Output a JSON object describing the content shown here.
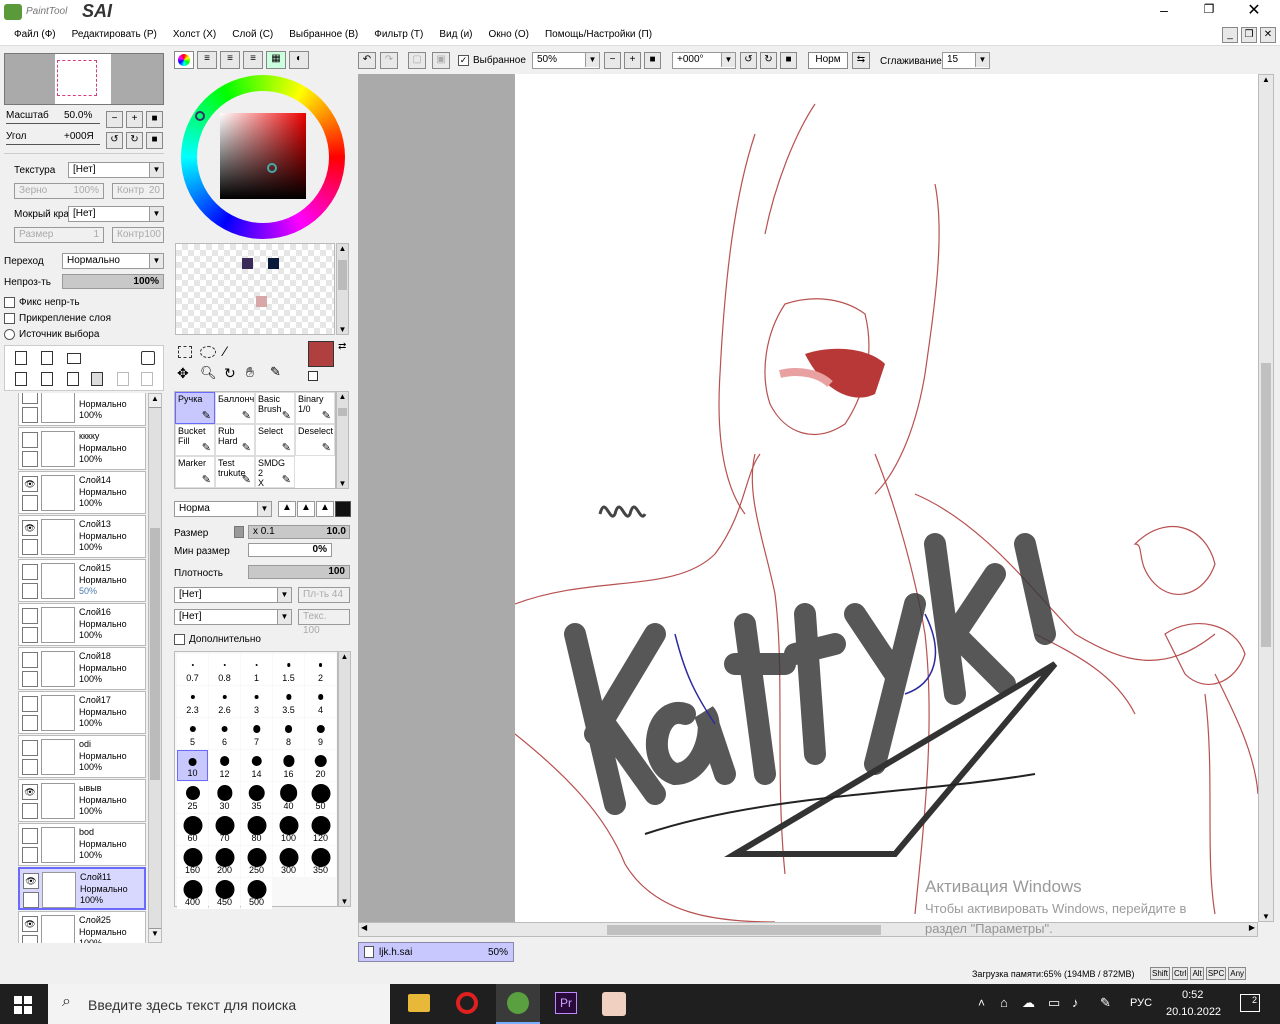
{
  "app": {
    "title_logo": "PaintTool SAI",
    "logo_small": "PaintTool",
    "logo_big": "SAI"
  },
  "menu": [
    "Файл (Ф)",
    "Редактировать (Р)",
    "Холст (Х)",
    "Слой (С)",
    "Выбранное (В)",
    "Фильтр (Т)",
    "Вид (и)",
    "Окно (О)",
    "Помощь/Настройки (П)"
  ],
  "navigator": {
    "zoom_label": "Масштаб",
    "zoom_value": "50.0%",
    "angle_label": "Угол",
    "angle_value": "+000Я"
  },
  "texture": {
    "label": "Текстура",
    "value": "[Нет]",
    "grain_label": "Зерно",
    "grain_value": "100%",
    "contrast_label": "Контр",
    "contrast_value": "20"
  },
  "wet_edge": {
    "label": "Мокрый край",
    "value": "[Нет]",
    "size_label": "Размер",
    "size_value": "1",
    "contrast_label": "Контр",
    "contrast_value": "100"
  },
  "blend": {
    "label": "Переход",
    "value": "Нормально",
    "opacity_label": "Непроз-ть",
    "opacity_value": "100%"
  },
  "options": {
    "fix_opacity": "Фикс непр-ть",
    "clip_layer": "Прикрепление слоя",
    "selection_source": "Источник выбора"
  },
  "layers": [
    {
      "name": "",
      "mode": "Нормально",
      "opacity": "100%",
      "visible": false
    },
    {
      "name": "кккку",
      "mode": "Нормально",
      "opacity": "100%",
      "visible": false
    },
    {
      "name": "Слой14",
      "mode": "Нормально",
      "opacity": "100%",
      "visible": true
    },
    {
      "name": "Слой13",
      "mode": "Нормально",
      "opacity": "100%",
      "visible": true
    },
    {
      "name": "Слой15",
      "mode": "Нормально",
      "opacity": "50%",
      "visible": false
    },
    {
      "name": "Слой16",
      "mode": "Нормально",
      "opacity": "100%",
      "visible": false
    },
    {
      "name": "Слой18",
      "mode": "Нормально",
      "opacity": "100%",
      "visible": false
    },
    {
      "name": "Слой17",
      "mode": "Нормально",
      "opacity": "100%",
      "visible": false
    },
    {
      "name": "odi",
      "mode": "Нормально",
      "opacity": "100%",
      "visible": false
    },
    {
      "name": "ывыв",
      "mode": "Нормально",
      "opacity": "100%",
      "visible": true
    },
    {
      "name": "bod",
      "mode": "Нормально",
      "opacity": "100%",
      "visible": false
    },
    {
      "name": "Слой11",
      "mode": "Нормально",
      "opacity": "100%",
      "visible": true,
      "selected": true
    },
    {
      "name": "Слой25",
      "mode": "Нормально",
      "opacity": "100%",
      "visible": true
    }
  ],
  "colors": {
    "primary": "#b04040",
    "secondary": "#555555",
    "swatch1": "#3a2a5a",
    "swatch2": "#0a1a3a",
    "swatch3": "#d8a8a8"
  },
  "tools": [
    {
      "l1": "Ручка",
      "l2": "",
      "selected": true
    },
    {
      "l1": "Баллонч",
      "l2": ""
    },
    {
      "l1": "Basic",
      "l2": "Brush"
    },
    {
      "l1": "Binary",
      "l2": "1/0"
    },
    {
      "l1": "Bucket",
      "l2": "Fill"
    },
    {
      "l1": "Rub",
      "l2": "Hard"
    },
    {
      "l1": "Select",
      "l2": ""
    },
    {
      "l1": "Deselect",
      "l2": ""
    },
    {
      "l1": "Marker",
      "l2": ""
    },
    {
      "l1": "Test",
      "l2": "trukute"
    },
    {
      "l1": "SMDG 2",
      "l2": "X"
    }
  ],
  "brush": {
    "mode": "Норма",
    "size_label": "Размер",
    "size_mult": "x 0.1",
    "size_value": "10.0",
    "min_size_label": "Мин размер",
    "min_size_value": "0%",
    "density_label": "Плотность",
    "density_value": "100",
    "shape1": "[Нет]",
    "shape1_extra": "Пл-ть 44",
    "shape2": "[Нет]",
    "shape2_extra": "Текс. 100",
    "advanced": "Дополнительно"
  },
  "sizes": [
    "0.7",
    "0.8",
    "1",
    "1.5",
    "2",
    "2.3",
    "2.6",
    "3",
    "3.5",
    "4",
    "5",
    "6",
    "7",
    "8",
    "9",
    "10",
    "12",
    "14",
    "16",
    "20",
    "25",
    "30",
    "35",
    "40",
    "50",
    "60",
    "70",
    "80",
    "100",
    "120",
    "160",
    "200",
    "250",
    "300",
    "350",
    "400",
    "450",
    "500"
  ],
  "toolbar": {
    "selection_check": "Выбранное",
    "zoom": "50%",
    "angle": "+000°",
    "mode": "Норм",
    "smoothing_label": "Сглаживание",
    "smoothing_value": "15"
  },
  "doc_tab": {
    "name": "ljk.h.sai",
    "zoom": "50%"
  },
  "status": {
    "memory": "Загрузка памяти:65% (194MB / 872MB)",
    "keys": [
      "Shift",
      "Ctrl",
      "Alt",
      "SPC",
      "Any"
    ]
  },
  "watermark": {
    "title": "Активация Windows",
    "line1": "Чтобы активировать Windows, перейдите в",
    "line2": "раздел \"Параметры\"."
  },
  "taskbar": {
    "search_placeholder": "Введите здесь текст для поиска",
    "lang": "РУС",
    "time": "0:52",
    "date": "20.10.2022",
    "notif": "2"
  }
}
